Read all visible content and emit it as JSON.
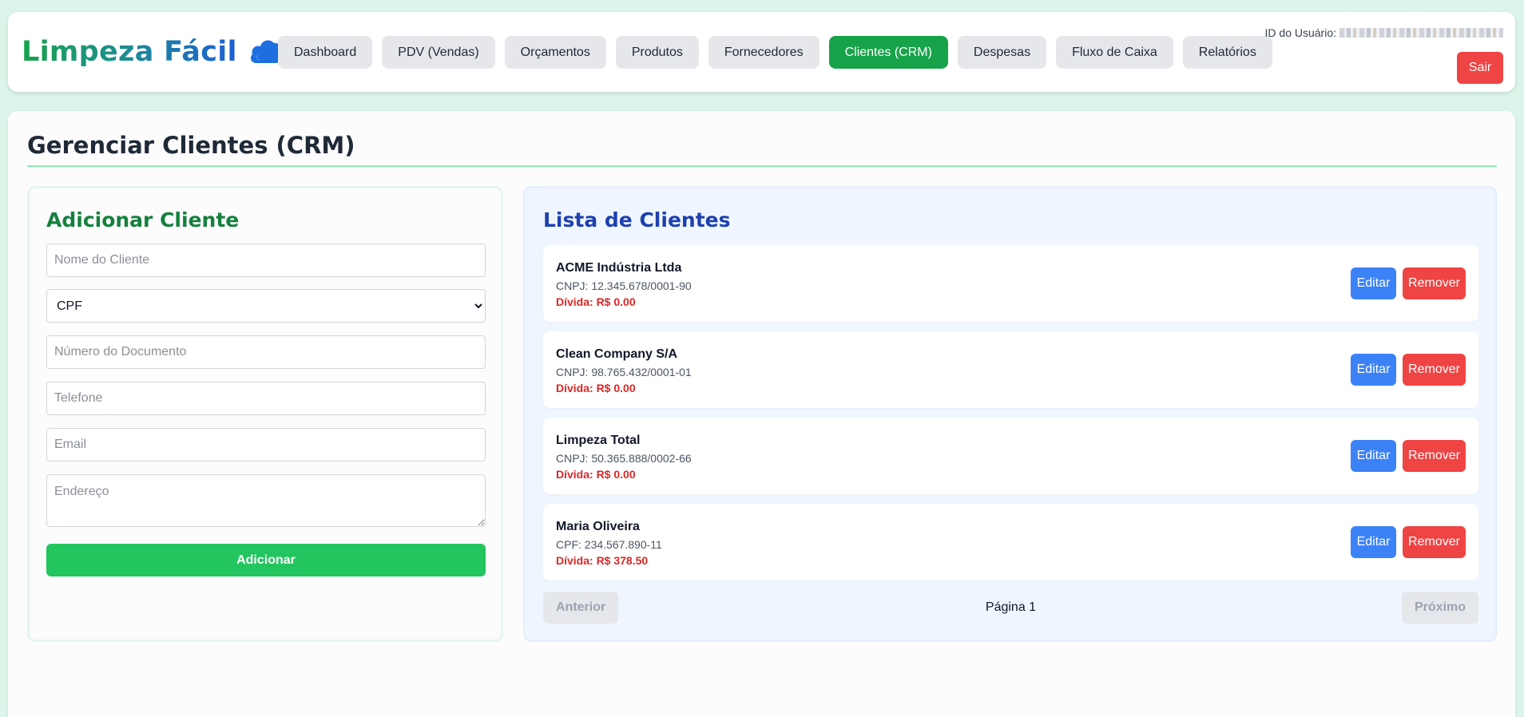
{
  "brand": {
    "name": "Limpeza Fácil",
    "icon": "cloud-icon",
    "color": "#1d6fe0"
  },
  "nav": {
    "items": [
      {
        "label": "Dashboard",
        "active": false
      },
      {
        "label": "PDV (Vendas)",
        "active": false
      },
      {
        "label": "Orçamentos",
        "active": false
      },
      {
        "label": "Produtos",
        "active": false
      },
      {
        "label": "Fornecedores",
        "active": false
      },
      {
        "label": "Clientes (CRM)",
        "active": true
      },
      {
        "label": "Despesas",
        "active": false
      },
      {
        "label": "Fluxo de Caixa",
        "active": false
      },
      {
        "label": "Relatórios",
        "active": false
      }
    ]
  },
  "user": {
    "id_label": "ID do Usuário:",
    "logout_label": "Sair"
  },
  "page": {
    "title": "Gerenciar Clientes (CRM)"
  },
  "form": {
    "title": "Adicionar Cliente",
    "name_placeholder": "Nome do Cliente",
    "doc_type_selected": "CPF",
    "doc_number_placeholder": "Número do Documento",
    "phone_placeholder": "Telefone",
    "email_placeholder": "Email",
    "address_placeholder": "Endereço",
    "submit_label": "Adicionar"
  },
  "list": {
    "title": "Lista de Clientes",
    "clients": [
      {
        "name": "ACME Indústria Ltda",
        "doc": "CNPJ: 12.345.678/0001-90",
        "debt": "Dívida: R$ 0.00"
      },
      {
        "name": "Clean Company S/A",
        "doc": "CNPJ: 98.765.432/0001-01",
        "debt": "Dívida: R$ 0.00"
      },
      {
        "name": "Limpeza Total",
        "doc": "CNPJ: 50.365.888/0002-66",
        "debt": "Dívida: R$ 0.00"
      },
      {
        "name": "Maria Oliveira",
        "doc": "CPF: 234.567.890-11",
        "debt": "Dívida: R$ 378.50"
      }
    ],
    "edit_label": "Editar",
    "remove_label": "Remover"
  },
  "pagination": {
    "prev_label": "Anterior",
    "page_label": "Página 1",
    "next_label": "Próximo"
  },
  "colors": {
    "primary_green": "#16a34a",
    "add_green": "#22c55e",
    "danger_red": "#ef4444",
    "edit_blue": "#3b82f6",
    "debt_red": "#dc2626",
    "list_bg": "#eff6ff"
  }
}
